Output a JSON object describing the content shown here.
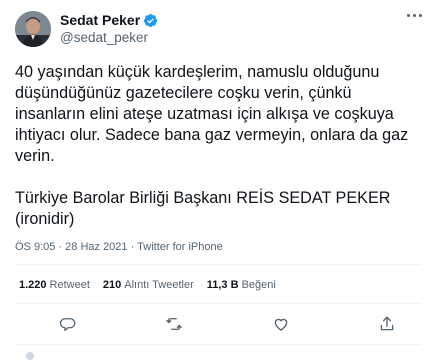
{
  "author": {
    "display_name": "Sedat Peker",
    "handle": "@sedat_peker",
    "verified_color": "#1d9bf0"
  },
  "tweet": {
    "lines": [
      "40 yaşından küçük kardeşlerim, namuslu olduğunu",
      "düşündüğünüz gazetecilere coşku verin, çünkü",
      "insanların elini ateşe uzatması için alkışa ve coşkuya",
      "ihtiyacı olur. Sadece bana gaz vermeyin, onlara da gaz",
      "verin.",
      "",
      "Türkiye Barolar Birliği Başkanı REİS SEDAT PEKER",
      "(ironidir)"
    ],
    "time": "ÖS 9:05",
    "date": "28 Haz 2021",
    "separator": "·",
    "source": "Twitter for iPhone"
  },
  "stats": {
    "retweets_count": "1.220",
    "retweets_label": "Retweet",
    "quotes_count": "210",
    "quotes_label": "Alıntı Tweetler",
    "likes_count": "11,3 B",
    "likes_label": "Beğeni"
  },
  "icons": {
    "reply": "reply-icon",
    "retweet": "retweet-icon",
    "like": "heart-icon",
    "share": "share-icon",
    "more": "more-dots-icon",
    "verified": "verified-badge-icon"
  },
  "colors": {
    "text": "#0f1419",
    "secondary": "#536471",
    "accent": "#1d9bf0",
    "divider": "#eff3f4"
  }
}
